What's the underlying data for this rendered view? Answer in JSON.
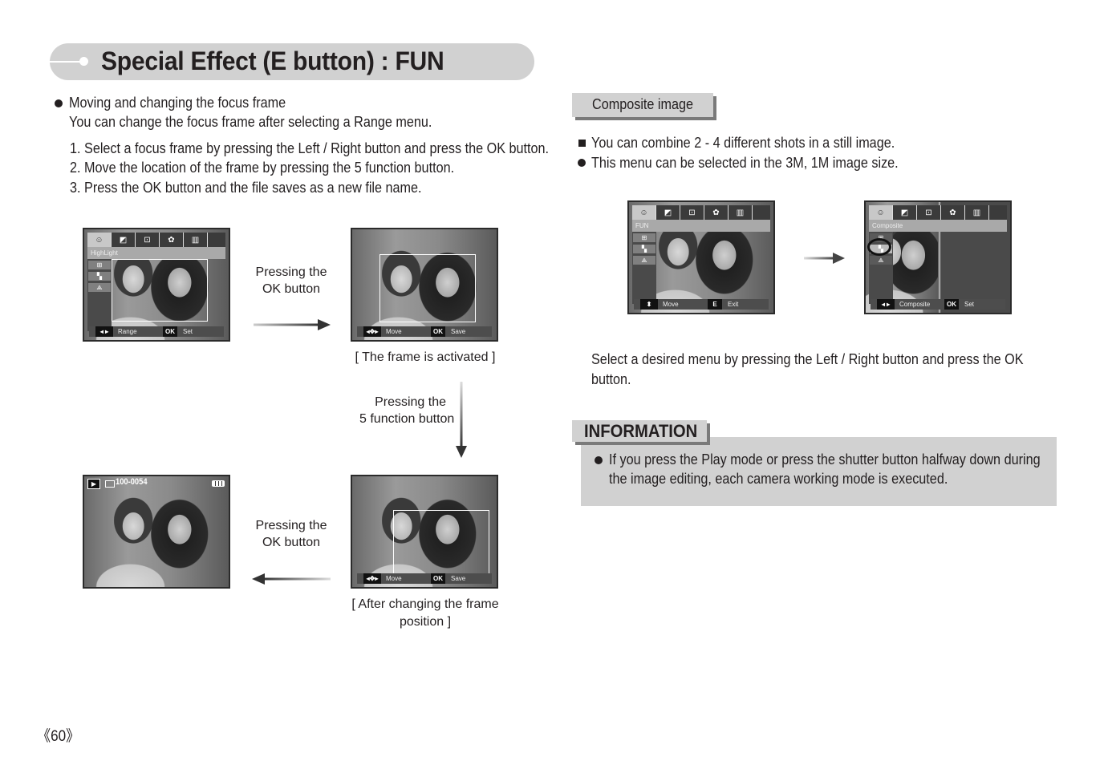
{
  "header": {
    "title": "Special Effect (E button) :  FUN"
  },
  "left": {
    "intro_heading": "Moving and changing the focus frame",
    "intro_text": "You can change the focus frame after selecting a Range menu.",
    "steps": [
      "1. Select a focus frame by pressing the Left / Right button and press the OK button.",
      "2. Move the location of the frame by pressing the 5 function button.",
      "3. Press the OK button and the file saves as a new file name."
    ],
    "screens": {
      "highlight": {
        "menu_label": "HighLight",
        "nav_key": "◂ ▸",
        "nav_label": "Range",
        "ok_key": "OK",
        "ok_label": "Set"
      },
      "activated": {
        "nav_key": "◂✥▸",
        "nav_label": "Move",
        "ok_key": "OK",
        "ok_label": "Save"
      },
      "changed": {
        "nav_key": "◂✥▸",
        "nav_label": "Move",
        "ok_key": "OK",
        "ok_label": "Save"
      },
      "playback": {
        "file_number": "100-0054"
      }
    },
    "captions": {
      "press_ok_1": [
        "Pressing the",
        "OK button"
      ],
      "activated": "[ The frame is activated ]",
      "press_5fn": [
        "Pressing the",
        "5 function button"
      ],
      "press_ok_2": [
        "Pressing the",
        "OK button"
      ],
      "changed": [
        "[ After changing the frame",
        "position ]"
      ]
    }
  },
  "right": {
    "section_tab": "Composite image",
    "bullets": [
      "You can combine 2 - 4 different shots in a still image.",
      "This menu can be selected in the 3M, 1M image size."
    ],
    "screens": {
      "fun": {
        "menu_label": "FUN",
        "nav_key": "⬍",
        "nav_label": "Move",
        "ok_key": "E",
        "ok_label": "Exit"
      },
      "composite": {
        "menu_label": "Composite",
        "nav_key": "◂ ▸",
        "nav_label": "Composite",
        "ok_key": "OK",
        "ok_label": "Set"
      }
    },
    "instruction": [
      "Select a desired menu by pressing the Left / Right button and press the OK",
      "button."
    ],
    "information": {
      "title": "INFORMATION",
      "text": [
        "If you press the Play mode or press the shutter button halfway down during",
        "the image editing, each camera working mode is executed."
      ]
    }
  },
  "menu_tabs": [
    "☺",
    "◩",
    "⊡",
    "✿",
    "▥"
  ],
  "side_items": [
    "⊞",
    "▚",
    "⟁"
  ],
  "footer": {
    "page_number": "《60》"
  }
}
